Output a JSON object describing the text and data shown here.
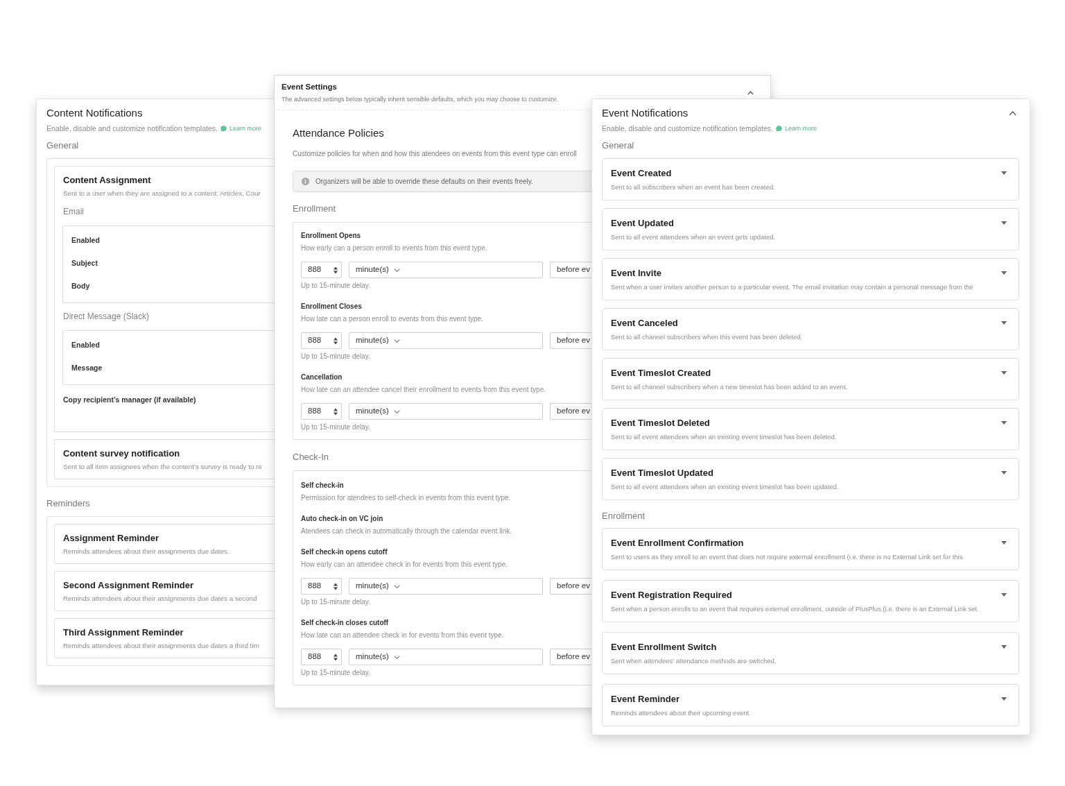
{
  "content_notifications": {
    "title": "Content Notifications",
    "subtitle": "Enable, disable and customize notification templates.",
    "learn_more": "Learn more",
    "sections": [
      {
        "heading": "General",
        "items": [
          {
            "title": "Content Assignment",
            "description": "Sent to a user when they are assigned to a content: Articles, Cour",
            "channels": [
              {
                "heading": "Email",
                "fields": [
                  "Enabled",
                  "Subject",
                  "Body"
                ]
              },
              {
                "heading": "Direct Message (Slack)",
                "fields": [
                  "Enabled",
                  "Message"
                ]
              }
            ],
            "option": "Copy recipient’s manager (if available)"
          },
          {
            "title": "Content survey notification",
            "description": "Sent to all item assignees when the content’s survey is ready to re"
          }
        ]
      },
      {
        "heading": "Reminders",
        "items": [
          {
            "title": "Assignment Reminder",
            "description": "Reminds attendees about their assignments due dates."
          },
          {
            "title": "Second Assignment Reminder",
            "description": "Reminds attendees about their assignments due dates a second"
          },
          {
            "title": "Third Assignment Reminder",
            "description": "Reminds attendees about their assignments due dates a third tim"
          }
        ]
      }
    ]
  },
  "event_settings": {
    "title": "Event Settings",
    "subtitle": "The advanced settings below typically inherit sensible defaults, which you may choose to customize.",
    "expanded": true,
    "policies": {
      "title": "Attendance Policies",
      "description": "Customize policies for when and how this atendees on events from this event type can enroll",
      "notice": "Organizers will be able to override these defaults on their events freely.",
      "groups": [
        {
          "heading": "Enrollment",
          "settings": [
            {
              "label": "Enrollment Opens",
              "description": "How early can a person enroll to events from this event type.",
              "amount": "888",
              "unit": "minute(s)",
              "relation": "before ev",
              "hint": "Up to 15-minute delay."
            },
            {
              "label": "Enrollment Closes",
              "description": "How late can a person enroll to events from this event type.",
              "amount": "888",
              "unit": "minute(s)",
              "relation": "before ev",
              "hint": "Up to 15-minute delay."
            },
            {
              "label": "Cancellation",
              "description": "How late can an attendee cancel their enrollment to events from this event type.",
              "amount": "888",
              "unit": "minute(s)",
              "relation": "before ev",
              "hint": "Up to 15-minute delay."
            }
          ]
        },
        {
          "heading": "Check-In",
          "settings": [
            {
              "label": "Self check-in",
              "description": "Permission for atendees to self-check in events from this event type."
            },
            {
              "label": "Auto check-in on VC join",
              "description": "Atendees can check in automatically through the calendar event link."
            },
            {
              "label": "Self check-in opens cutoff",
              "description": "How early can an attendee check in for events from this event type.",
              "amount": "888",
              "unit": "minute(s)",
              "relation": "before ev",
              "hint": "Up to 15-minute delay."
            },
            {
              "label": "Self check-in closes cutoff",
              "description": "How late can an attendee check in for events from this event type.",
              "amount": "888",
              "unit": "minute(s)",
              "relation": "before ev",
              "hint": "Up to 15-minute delay."
            }
          ]
        }
      ]
    }
  },
  "event_notifications": {
    "title": "Event Notifications",
    "subtitle": "Enable, disable and customize notification templates.",
    "learn_more": "Learn more",
    "expanded": true,
    "sections": [
      {
        "heading": "General",
        "items": [
          {
            "title": "Event Created",
            "description": "Sent to all subscribers when an event has been created.",
            "expanded": false
          },
          {
            "title": "Event Updated",
            "description": "Sent to all event attendees when an event gets updated.",
            "expanded": false
          },
          {
            "title": "Event Invite",
            "description": "Sent when a user invites another person to a particular event. The email invitation may contain a personal message from the",
            "expanded": false
          },
          {
            "title": "Event Canceled",
            "description": "Sent to all channel subscribers when this event has been deleted.",
            "expanded": false
          },
          {
            "title": "Event Timeslot Created",
            "description": "Sent to all channel subscribers when a new timeslot has been added to an event.",
            "expanded": false
          },
          {
            "title": "Event Timeslot Deleted",
            "description": "Sent to all event attendees when an existing event timeslot has been deleted.",
            "expanded": false
          },
          {
            "title": "Event Timeslot Updated",
            "description": "Sent to all event attendees when an existing event timeslot has been updated.",
            "expanded": false
          }
        ]
      },
      {
        "heading": "Enrollment",
        "items": [
          {
            "title": "Event Enrollment Confirmation",
            "description": "Sent to users as they enroll to an event that does not require external enrollment (i.e. there is no External Link set for this",
            "expanded": false
          },
          {
            "title": "Event Registration Required",
            "description": "Sent when a person enrolls to an event that requires external enrollment, outside of PlusPlus.(i.e. there is an External Link set",
            "expanded": false
          },
          {
            "title": "Event Enrollment Switch",
            "description": "Sent when attendees' attendance methods are switched.",
            "expanded": false
          },
          {
            "title": "Event Reminder",
            "description": "Reminds attendees about their upcoming event.",
            "expanded": false
          }
        ]
      }
    ]
  }
}
